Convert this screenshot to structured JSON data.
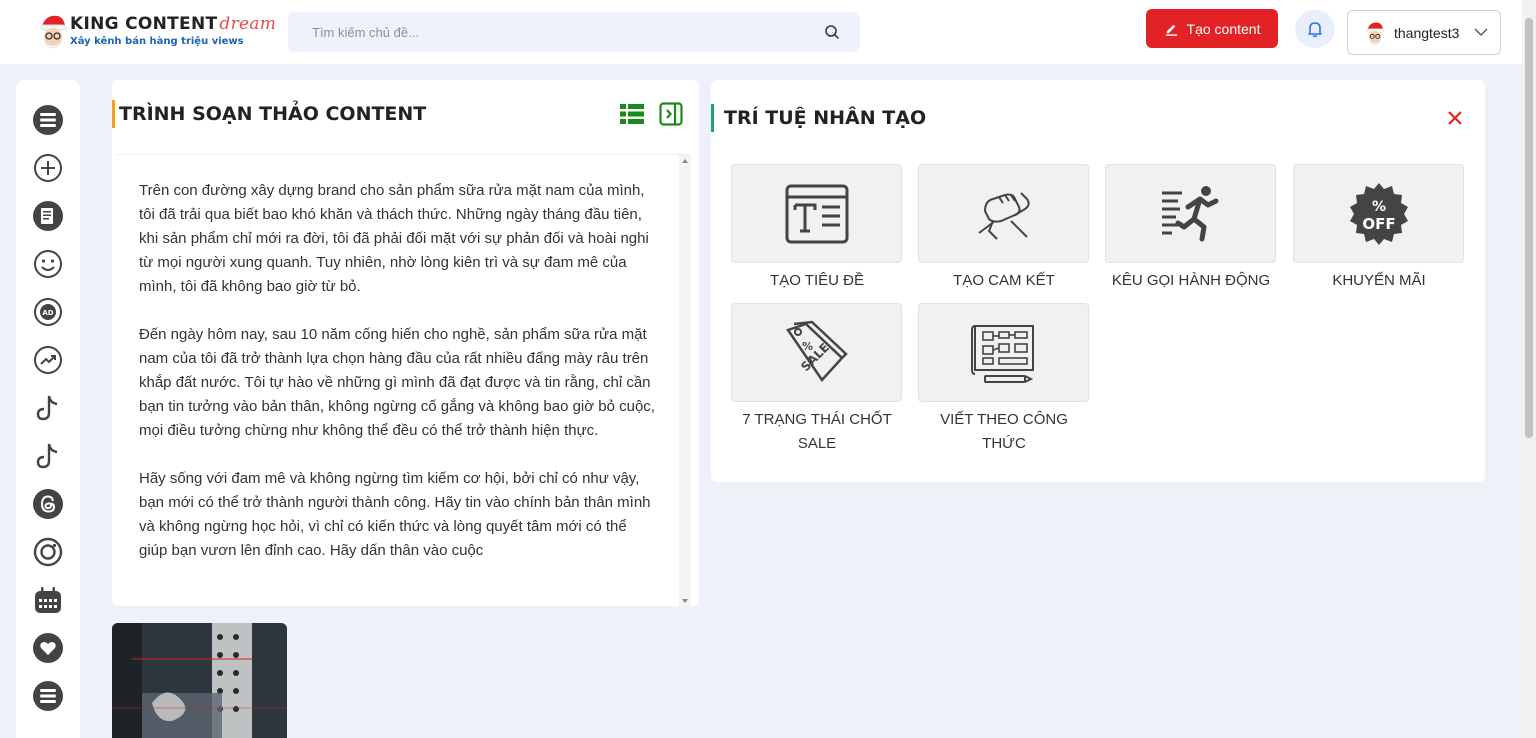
{
  "header": {
    "logo_title": "KING CONTENT",
    "logo_title_accent": "dream",
    "logo_subtitle": "Xây kênh bán hàng triệu views",
    "search_placeholder": "Tìm kiếm chủ đề...",
    "create_button_label": "Tạo content",
    "username": "thangtest3"
  },
  "sidebar": {
    "icons": [
      "list-icon",
      "plus-circle-icon",
      "document-icon",
      "smile-icon",
      "ad-icon",
      "trending-icon",
      "tiktok-icon",
      "tiktok-icon",
      "threads-icon",
      "instagram-icon",
      "calendar-icon",
      "heart-icon",
      "list-icon"
    ]
  },
  "editor": {
    "title": "TRÌNH SOẠN THẢO CONTENT",
    "paragraphs": [
      "Trên con đường xây dựng brand cho sản phẩm sữa rửa mặt nam của mình, tôi đã trải qua biết bao khó khăn và thách thức. Những ngày tháng đầu tiên, khi sản phẩm chỉ mới ra đời, tôi đã phải đối mặt với sự phản đối và hoài nghi từ mọi người xung quanh. Tuy nhiên, nhờ lòng kiên trì và sự đam mê của mình, tôi đã không bao giờ từ bỏ.",
      "Đến ngày hôm nay, sau 10 năm cống hiến cho nghề, sản phẩm sữa rửa mặt nam của tôi đã trở thành lựa chọn hàng đầu của rất nhiều đấng mày râu trên khắp đất nước. Tôi tự hào về những gì mình đã đạt được và tin rằng, chỉ cần bạn tin tưởng vào bản thân, không ngừng cố gắng và không bao giờ bỏ cuộc, mọi điều tưởng chừng như không thể đều có thể trở thành hiện thực.",
      "Hãy sống với đam mê và không ngừng tìm kiếm cơ hội, bởi chỉ có như vậy, bạn mới có thể trở thành người thành công. Hãy tin vào chính bản thân mình và không ngừng học hỏi, vì chỉ có kiến thức và lòng quyết tâm mới có thể giúp bạn vươn lên đỉnh cao. Hãy dấn thân vào cuộc"
    ]
  },
  "ai_panel": {
    "title": "TRÍ TUỆ NHÂN TẠO",
    "tools": [
      {
        "label": "TẠO TIÊU ĐỀ",
        "icon": "title-text-icon"
      },
      {
        "label": "TẠO CAM KẾT",
        "icon": "handshake-icon"
      },
      {
        "label": "KÊU GỌI HÀNH ĐỘNG",
        "icon": "running-man-icon"
      },
      {
        "label": "KHUYẾN MÃI",
        "icon": "percent-off-badge-icon"
      },
      {
        "label": "7 TRẠNG THÁI CHỐT SALE",
        "icon": "sale-tag-icon"
      },
      {
        "label": "VIẾT THEO CÔNG THỨC",
        "icon": "formula-blueprint-icon"
      }
    ]
  },
  "colors": {
    "accent_red": "#e32226",
    "editor_title_bar": "#f0a21d",
    "ai_title_bar": "#1aa37a",
    "tool_icon_green": "#1a8a1a"
  }
}
